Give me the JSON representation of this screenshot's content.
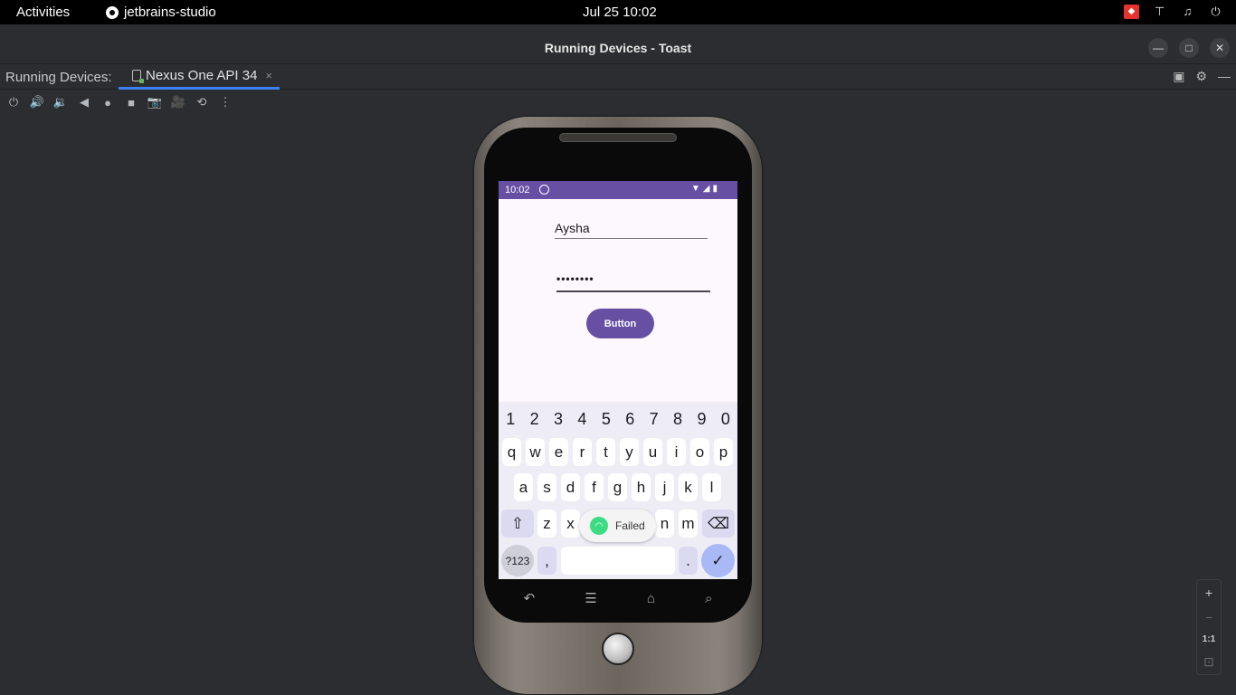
{
  "topbar": {
    "activities": "Activities",
    "app_name": "jetbrains-studio",
    "clock": "Jul 25  10:02"
  },
  "window": {
    "title": "Running Devices - Toast"
  },
  "tool_window": {
    "label": "Running Devices:",
    "tab_label": "Nexus One API 34",
    "tab_close": "×"
  },
  "phone": {
    "status_time": "10:02",
    "username_value": "Aysha",
    "password_value": "••••••••",
    "button_label": "Button",
    "toast_text": "Failed",
    "keyboard": {
      "numbers": [
        "1",
        "2",
        "3",
        "4",
        "5",
        "6",
        "7",
        "8",
        "9",
        "0"
      ],
      "row1": [
        "q",
        "w",
        "e",
        "r",
        "t",
        "y",
        "u",
        "i",
        "o",
        "p"
      ],
      "row2": [
        "a",
        "s",
        "d",
        "f",
        "g",
        "h",
        "j",
        "k",
        "l"
      ],
      "row3_left": [
        "z",
        "x"
      ],
      "row3_right": [
        "n",
        "m"
      ],
      "sym_label": "?123",
      "comma": ",",
      "period": "."
    }
  },
  "zoom": {
    "plus": "+",
    "minus": "−",
    "one_to_one": "1:1"
  },
  "colors": {
    "accent": "#6750a4",
    "tab_underline": "#3d7ff5",
    "android_green": "#3ddc84"
  },
  "icons": {
    "power": "power-icon",
    "volume_up": "volume-up-icon",
    "volume_down": "volume-down-icon",
    "back": "back-icon",
    "home": "home-icon",
    "overview": "overview-icon",
    "screenshot": "camera-icon",
    "record": "video-icon",
    "reset": "reset-icon",
    "more": "more-icon"
  }
}
